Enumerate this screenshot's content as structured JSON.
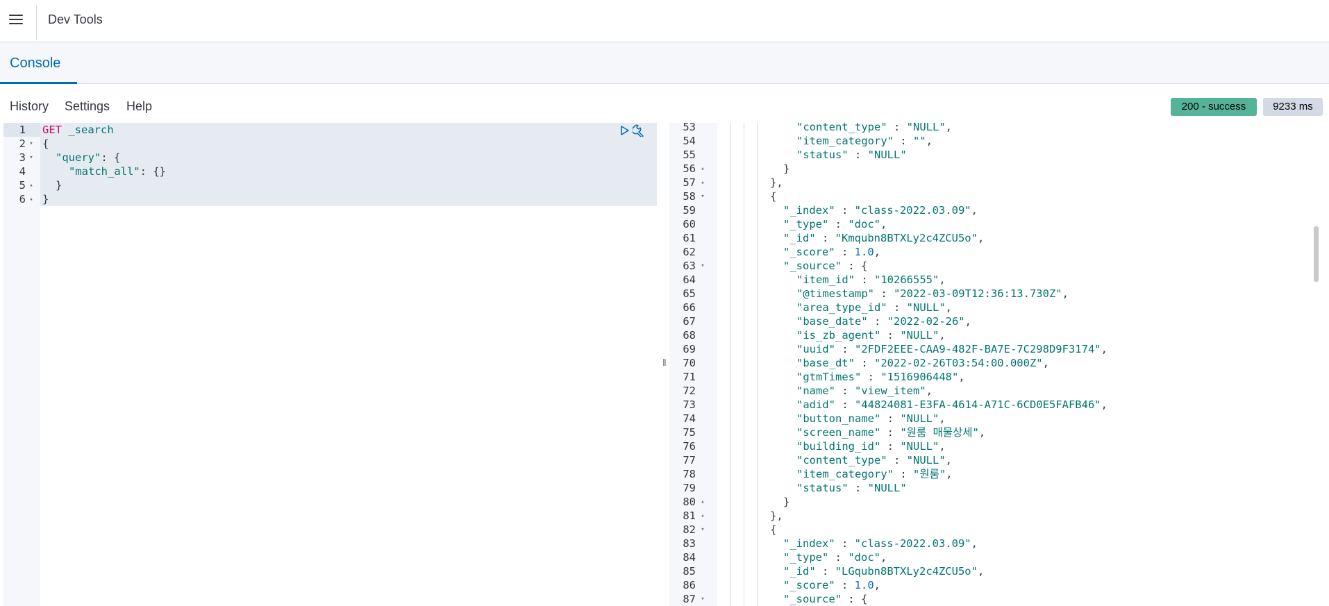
{
  "header": {
    "title": "Dev Tools"
  },
  "tabs": [
    {
      "label": "Console",
      "active": true
    }
  ],
  "menu": {
    "history": "History",
    "settings": "Settings",
    "help": "Help"
  },
  "status": {
    "code_text": "200 - success",
    "time_text": "9233 ms",
    "status_color": "#54b399"
  },
  "request": {
    "lines": [
      {
        "n": "1",
        "fold": "",
        "indent": 0,
        "tokens": [
          {
            "t": "GET",
            "c": "k-method"
          },
          {
            "t": " _search",
            "c": "k-url"
          }
        ]
      },
      {
        "n": "2",
        "fold": "down",
        "indent": 0,
        "tokens": [
          {
            "t": "{",
            "c": "punc"
          }
        ]
      },
      {
        "n": "3",
        "fold": "down",
        "indent": 1,
        "tokens": [
          {
            "t": "\"query\"",
            "c": "k-str"
          },
          {
            "t": ": {",
            "c": "punc"
          }
        ]
      },
      {
        "n": "4",
        "fold": "",
        "indent": 2,
        "tokens": [
          {
            "t": "\"match_all\"",
            "c": "k-str"
          },
          {
            "t": ": {}",
            "c": "punc"
          }
        ]
      },
      {
        "n": "5",
        "fold": "up",
        "indent": 1,
        "tokens": [
          {
            "t": "}",
            "c": "punc"
          }
        ]
      },
      {
        "n": "6",
        "fold": "up",
        "indent": 0,
        "tokens": [
          {
            "t": "}",
            "c": "punc"
          }
        ]
      }
    ]
  },
  "response": {
    "lines": [
      {
        "n": "53",
        "fold": "",
        "indent": 5,
        "tokens": [
          {
            "t": "\"content_type\"",
            "c": "k-str"
          },
          {
            "t": " : ",
            "c": "punc"
          },
          {
            "t": "\"NULL\"",
            "c": "k-val"
          },
          {
            "t": ",",
            "c": "punc"
          }
        ]
      },
      {
        "n": "54",
        "fold": "",
        "indent": 5,
        "tokens": [
          {
            "t": "\"item_category\"",
            "c": "k-str"
          },
          {
            "t": " : ",
            "c": "punc"
          },
          {
            "t": "\"\"",
            "c": "k-val"
          },
          {
            "t": ",",
            "c": "punc"
          }
        ]
      },
      {
        "n": "55",
        "fold": "",
        "indent": 5,
        "tokens": [
          {
            "t": "\"status\"",
            "c": "k-str"
          },
          {
            "t": " : ",
            "c": "punc"
          },
          {
            "t": "\"NULL\"",
            "c": "k-val"
          }
        ]
      },
      {
        "n": "56",
        "fold": "up",
        "indent": 4,
        "tokens": [
          {
            "t": "}",
            "c": "punc"
          }
        ]
      },
      {
        "n": "57",
        "fold": "up",
        "indent": 3,
        "tokens": [
          {
            "t": "},",
            "c": "punc"
          }
        ]
      },
      {
        "n": "58",
        "fold": "down",
        "indent": 3,
        "tokens": [
          {
            "t": "{",
            "c": "punc"
          }
        ]
      },
      {
        "n": "59",
        "fold": "",
        "indent": 4,
        "tokens": [
          {
            "t": "\"_index\"",
            "c": "k-str"
          },
          {
            "t": " : ",
            "c": "punc"
          },
          {
            "t": "\"class-2022.03.09\"",
            "c": "k-val"
          },
          {
            "t": ",",
            "c": "punc"
          }
        ]
      },
      {
        "n": "60",
        "fold": "",
        "indent": 4,
        "tokens": [
          {
            "t": "\"_type\"",
            "c": "k-str"
          },
          {
            "t": " : ",
            "c": "punc"
          },
          {
            "t": "\"doc\"",
            "c": "k-val"
          },
          {
            "t": ",",
            "c": "punc"
          }
        ]
      },
      {
        "n": "61",
        "fold": "",
        "indent": 4,
        "tokens": [
          {
            "t": "\"_id\"",
            "c": "k-str"
          },
          {
            "t": " : ",
            "c": "punc"
          },
          {
            "t": "\"Kmqubn8BTXLy2c4ZCU5o\"",
            "c": "k-val"
          },
          {
            "t": ",",
            "c": "punc"
          }
        ]
      },
      {
        "n": "62",
        "fold": "",
        "indent": 4,
        "tokens": [
          {
            "t": "\"_score\"",
            "c": "k-str"
          },
          {
            "t": " : ",
            "c": "punc"
          },
          {
            "t": "1.0",
            "c": "k-num"
          },
          {
            "t": ",",
            "c": "punc"
          }
        ]
      },
      {
        "n": "63",
        "fold": "down",
        "indent": 4,
        "tokens": [
          {
            "t": "\"_source\"",
            "c": "k-str"
          },
          {
            "t": " : {",
            "c": "punc"
          }
        ]
      },
      {
        "n": "64",
        "fold": "",
        "indent": 5,
        "tokens": [
          {
            "t": "\"item_id\"",
            "c": "k-str"
          },
          {
            "t": " : ",
            "c": "punc"
          },
          {
            "t": "\"10266555\"",
            "c": "k-val"
          },
          {
            "t": ",",
            "c": "punc"
          }
        ]
      },
      {
        "n": "65",
        "fold": "",
        "indent": 5,
        "tokens": [
          {
            "t": "\"@timestamp\"",
            "c": "k-str"
          },
          {
            "t": " : ",
            "c": "punc"
          },
          {
            "t": "\"2022-03-09T12:36:13.730Z\"",
            "c": "k-val"
          },
          {
            "t": ",",
            "c": "punc"
          }
        ]
      },
      {
        "n": "66",
        "fold": "",
        "indent": 5,
        "tokens": [
          {
            "t": "\"area_type_id\"",
            "c": "k-str"
          },
          {
            "t": " : ",
            "c": "punc"
          },
          {
            "t": "\"NULL\"",
            "c": "k-val"
          },
          {
            "t": ",",
            "c": "punc"
          }
        ]
      },
      {
        "n": "67",
        "fold": "",
        "indent": 5,
        "tokens": [
          {
            "t": "\"base_date\"",
            "c": "k-str"
          },
          {
            "t": " : ",
            "c": "punc"
          },
          {
            "t": "\"2022-02-26\"",
            "c": "k-val"
          },
          {
            "t": ",",
            "c": "punc"
          }
        ]
      },
      {
        "n": "68",
        "fold": "",
        "indent": 5,
        "tokens": [
          {
            "t": "\"is_zb_agent\"",
            "c": "k-str"
          },
          {
            "t": " : ",
            "c": "punc"
          },
          {
            "t": "\"NULL\"",
            "c": "k-val"
          },
          {
            "t": ",",
            "c": "punc"
          }
        ]
      },
      {
        "n": "69",
        "fold": "",
        "indent": 5,
        "tokens": [
          {
            "t": "\"uuid\"",
            "c": "k-str"
          },
          {
            "t": " : ",
            "c": "punc"
          },
          {
            "t": "\"2FDF2EEE-CAA9-482F-BA7E-7C298D9F3174\"",
            "c": "k-val"
          },
          {
            "t": ",",
            "c": "punc"
          }
        ]
      },
      {
        "n": "70",
        "fold": "",
        "indent": 5,
        "tokens": [
          {
            "t": "\"base_dt\"",
            "c": "k-str"
          },
          {
            "t": " : ",
            "c": "punc"
          },
          {
            "t": "\"2022-02-26T03:54:00.000Z\"",
            "c": "k-val"
          },
          {
            "t": ",",
            "c": "punc"
          }
        ]
      },
      {
        "n": "71",
        "fold": "",
        "indent": 5,
        "tokens": [
          {
            "t": "\"gtmTimes\"",
            "c": "k-str"
          },
          {
            "t": " : ",
            "c": "punc"
          },
          {
            "t": "\"1516906448\"",
            "c": "k-val"
          },
          {
            "t": ",",
            "c": "punc"
          }
        ]
      },
      {
        "n": "72",
        "fold": "",
        "indent": 5,
        "tokens": [
          {
            "t": "\"name\"",
            "c": "k-str"
          },
          {
            "t": " : ",
            "c": "punc"
          },
          {
            "t": "\"view_item\"",
            "c": "k-val"
          },
          {
            "t": ",",
            "c": "punc"
          }
        ]
      },
      {
        "n": "73",
        "fold": "",
        "indent": 5,
        "tokens": [
          {
            "t": "\"adid\"",
            "c": "k-str"
          },
          {
            "t": " : ",
            "c": "punc"
          },
          {
            "t": "\"44824081-E3FA-4614-A71C-6CD0E5FAFB46\"",
            "c": "k-val"
          },
          {
            "t": ",",
            "c": "punc"
          }
        ]
      },
      {
        "n": "74",
        "fold": "",
        "indent": 5,
        "tokens": [
          {
            "t": "\"button_name\"",
            "c": "k-str"
          },
          {
            "t": " : ",
            "c": "punc"
          },
          {
            "t": "\"NULL\"",
            "c": "k-val"
          },
          {
            "t": ",",
            "c": "punc"
          }
        ]
      },
      {
        "n": "75",
        "fold": "",
        "indent": 5,
        "tokens": [
          {
            "t": "\"screen_name\"",
            "c": "k-str"
          },
          {
            "t": " : ",
            "c": "punc"
          },
          {
            "t": "\"원룸 매물상세\"",
            "c": "k-val"
          },
          {
            "t": ",",
            "c": "punc"
          }
        ]
      },
      {
        "n": "76",
        "fold": "",
        "indent": 5,
        "tokens": [
          {
            "t": "\"building_id\"",
            "c": "k-str"
          },
          {
            "t": " : ",
            "c": "punc"
          },
          {
            "t": "\"NULL\"",
            "c": "k-val"
          },
          {
            "t": ",",
            "c": "punc"
          }
        ]
      },
      {
        "n": "77",
        "fold": "",
        "indent": 5,
        "tokens": [
          {
            "t": "\"content_type\"",
            "c": "k-str"
          },
          {
            "t": " : ",
            "c": "punc"
          },
          {
            "t": "\"NULL\"",
            "c": "k-val"
          },
          {
            "t": ",",
            "c": "punc"
          }
        ]
      },
      {
        "n": "78",
        "fold": "",
        "indent": 5,
        "tokens": [
          {
            "t": "\"item_category\"",
            "c": "k-str"
          },
          {
            "t": " : ",
            "c": "punc"
          },
          {
            "t": "\"원룸\"",
            "c": "k-val"
          },
          {
            "t": ",",
            "c": "punc"
          }
        ]
      },
      {
        "n": "79",
        "fold": "",
        "indent": 5,
        "tokens": [
          {
            "t": "\"status\"",
            "c": "k-str"
          },
          {
            "t": " : ",
            "c": "punc"
          },
          {
            "t": "\"NULL\"",
            "c": "k-val"
          }
        ]
      },
      {
        "n": "80",
        "fold": "up",
        "indent": 4,
        "tokens": [
          {
            "t": "}",
            "c": "punc"
          }
        ]
      },
      {
        "n": "81",
        "fold": "up",
        "indent": 3,
        "tokens": [
          {
            "t": "},",
            "c": "punc"
          }
        ]
      },
      {
        "n": "82",
        "fold": "down",
        "indent": 3,
        "tokens": [
          {
            "t": "{",
            "c": "punc"
          }
        ]
      },
      {
        "n": "83",
        "fold": "",
        "indent": 4,
        "tokens": [
          {
            "t": "\"_index\"",
            "c": "k-str"
          },
          {
            "t": " : ",
            "c": "punc"
          },
          {
            "t": "\"class-2022.03.09\"",
            "c": "k-val"
          },
          {
            "t": ",",
            "c": "punc"
          }
        ]
      },
      {
        "n": "84",
        "fold": "",
        "indent": 4,
        "tokens": [
          {
            "t": "\"_type\"",
            "c": "k-str"
          },
          {
            "t": " : ",
            "c": "punc"
          },
          {
            "t": "\"doc\"",
            "c": "k-val"
          },
          {
            "t": ",",
            "c": "punc"
          }
        ]
      },
      {
        "n": "85",
        "fold": "",
        "indent": 4,
        "tokens": [
          {
            "t": "\"_id\"",
            "c": "k-str"
          },
          {
            "t": " : ",
            "c": "punc"
          },
          {
            "t": "\"LGqubn8BTXLy2c4ZCU5o\"",
            "c": "k-val"
          },
          {
            "t": ",",
            "c": "punc"
          }
        ]
      },
      {
        "n": "86",
        "fold": "",
        "indent": 4,
        "tokens": [
          {
            "t": "\"_score\"",
            "c": "k-str"
          },
          {
            "t": " : ",
            "c": "punc"
          },
          {
            "t": "1.0",
            "c": "k-num"
          },
          {
            "t": ",",
            "c": "punc"
          }
        ]
      },
      {
        "n": "87",
        "fold": "down",
        "indent": 4,
        "tokens": [
          {
            "t": "\"_source\"",
            "c": "k-str"
          },
          {
            "t": " : {",
            "c": "punc"
          }
        ]
      }
    ]
  },
  "icons": {
    "menu": "hamburger-icon",
    "run": "play-icon",
    "wrench": "wrench-icon",
    "resizer": "drag-handle-icon"
  }
}
